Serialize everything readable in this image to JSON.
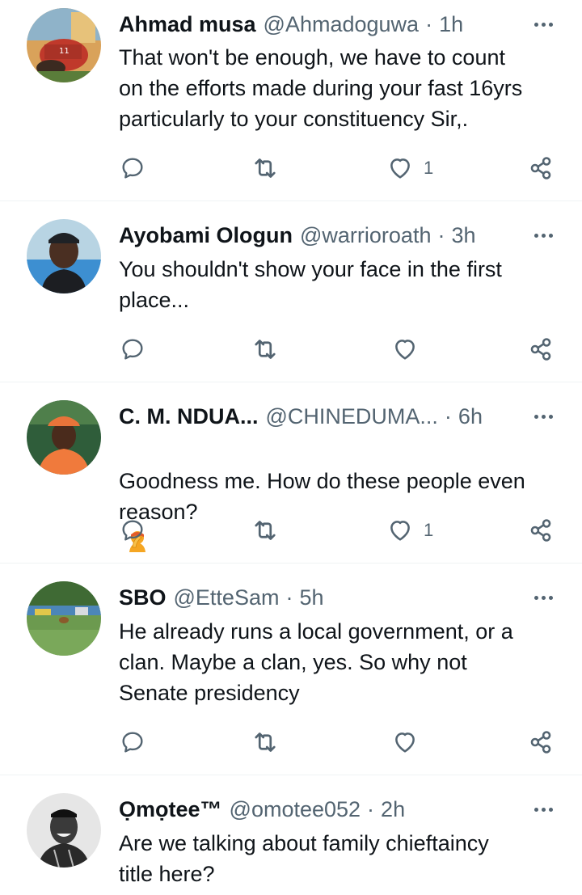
{
  "replies": [
    {
      "name": "Ahmad musa",
      "handle": "@Ahmadoguwa",
      "time": "1h",
      "text": "That won't be enough, we have to count\non the efforts made during your fast 16yrs\nparticularly to your constituency Sir,.",
      "likes": "1"
    },
    {
      "name": "Ayobami Ologun",
      "handle": "@warrioroath",
      "time": "3h",
      "text": "You shouldn't show your face in the first\nplace...",
      "likes": ""
    },
    {
      "name": "C. M. NDUA...",
      "handle": "@CHINEDUMA...",
      "time": "6h",
      "text": "Goodness me. How do these people even\nreason?",
      "emoji": "facepalm",
      "likes": "1"
    },
    {
      "name": "SBO",
      "handle": "@EtteSam",
      "time": "5h",
      "text": "He already runs a local government, or a\nclan. Maybe a clan, yes. So why not\nSenate presidency",
      "likes": ""
    },
    {
      "name": "Ọmọtee™",
      "handle": "@omotee052",
      "time": "2h",
      "text": "Are we talking about family chieftaincy\ntitle here?",
      "likes": ""
    }
  ],
  "separator": "·",
  "icons": {
    "reply": "reply-icon",
    "retweet": "retweet-icon",
    "like": "heart-icon",
    "share": "share-icon",
    "more": "more-dots-icon"
  },
  "colors": {
    "text": "#0f1419",
    "secondary": "#536471",
    "divider": "#eff3f4"
  }
}
